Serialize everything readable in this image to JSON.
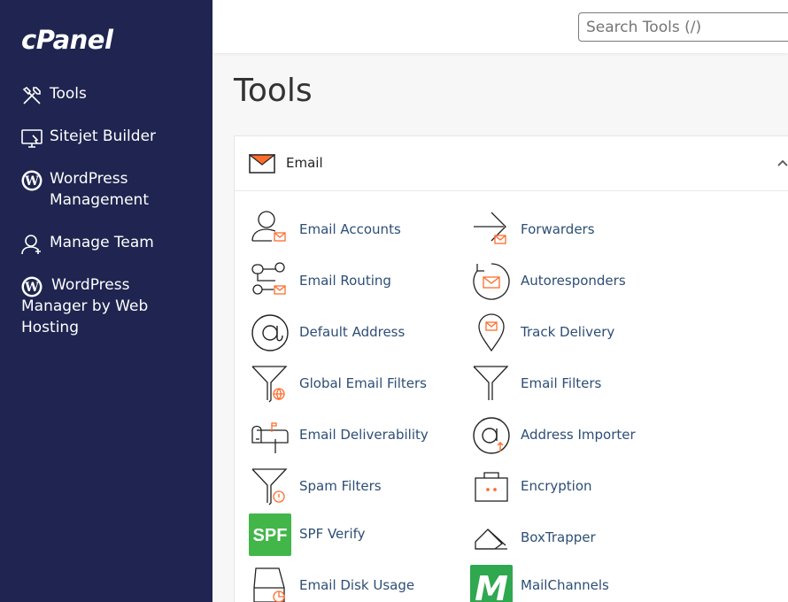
{
  "brand": {
    "logo_text": "cPanel"
  },
  "sidebar": {
    "items": [
      {
        "label": "Tools",
        "icon": "tools-icon"
      },
      {
        "label": "Sitejet Builder",
        "icon": "sitejet-icon"
      },
      {
        "label": "WordPress Management",
        "icon": "wordpress-icon"
      },
      {
        "label": "Manage Team",
        "icon": "manage-team-icon"
      },
      {
        "label": "WordPress Manager by Web Hosting",
        "icon": "wordpress-icon"
      }
    ]
  },
  "header": {
    "search_placeholder": "Search Tools (/)"
  },
  "main": {
    "title": "Tools",
    "section": {
      "title": "Email",
      "left_tools": [
        "Email Accounts",
        "Email Routing",
        "Default Address",
        "Global Email Filters",
        "Email Deliverability",
        "Spam Filters",
        "SPF Verify",
        "Email Disk Usage"
      ],
      "right_tools": [
        "Forwarders",
        "Autoresponders",
        "Track Delivery",
        "Email Filters",
        "Address Importer",
        "Encryption",
        "BoxTrapper",
        "MailChannels"
      ],
      "badges": {
        "spf": "SPF",
        "mailchannels": "M"
      }
    }
  },
  "colors": {
    "sidebar_bg": "#1f2550",
    "accent": "#ff6c2c",
    "link": "#2d4e76",
    "spf_green": "#43b649"
  }
}
